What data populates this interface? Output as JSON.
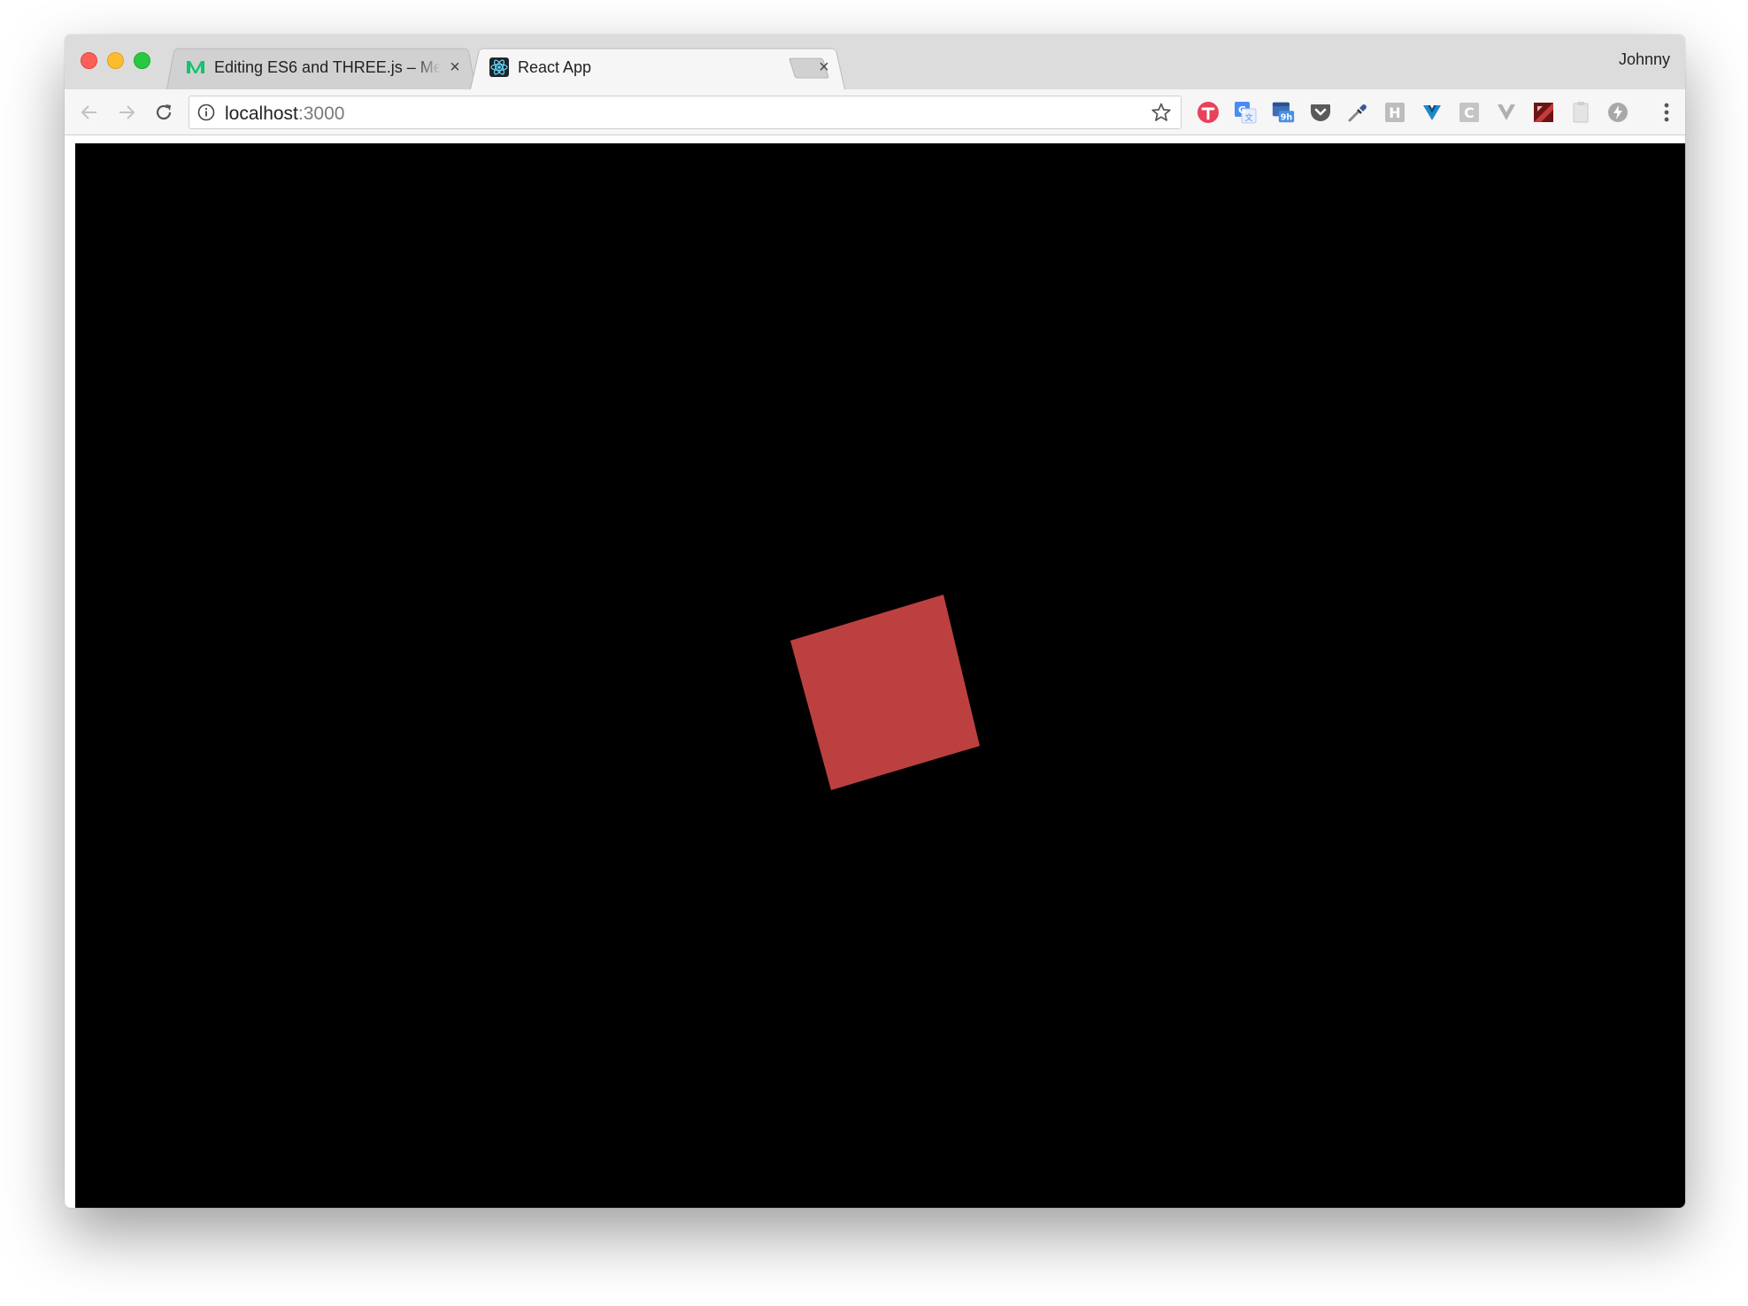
{
  "window": {
    "profile_name": "Johnny",
    "tabs": [
      {
        "title": "Editing ES6 and THREE.js – Me",
        "active": false,
        "favicon": "medium-icon"
      },
      {
        "title": "React App",
        "active": true,
        "favicon": "react-icon"
      }
    ]
  },
  "toolbar": {
    "url_host": "localhost",
    "url_port": ":3000",
    "extensions": [
      "todoist-icon",
      "google-translate-icon",
      "calendar-9h-icon",
      "pocket-icon",
      "eyedropper-icon",
      "h-extension-icon",
      "vue-devtools-icon",
      "c-extension-icon",
      "v-extension-icon",
      "red-square-extension-icon",
      "clipboard-icon",
      "lightning-icon"
    ]
  },
  "scene": {
    "background": "#000000",
    "cube_color": "#bd4040"
  }
}
